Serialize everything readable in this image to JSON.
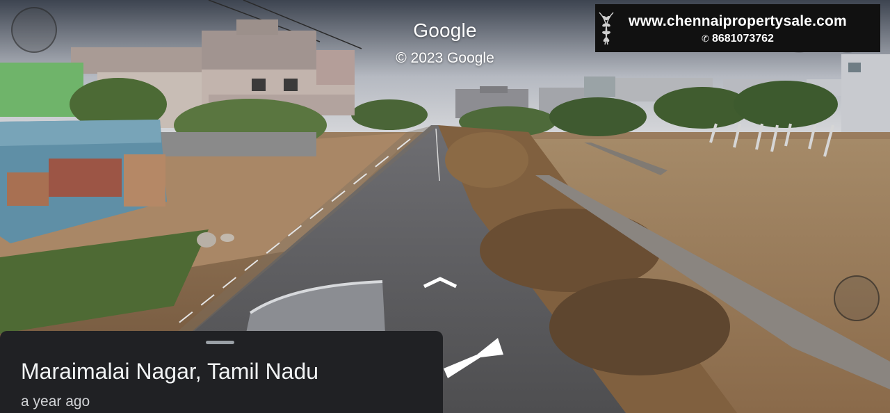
{
  "viewer": {
    "logo": "Google",
    "copyright": "© 2023 Google"
  },
  "banner": {
    "website": "www.chennaipropertysale.com",
    "phone": "8681073762",
    "phone_icon": "phone-icon"
  },
  "location_card": {
    "place": "Maraimalai Nagar, Tamil Nadu",
    "captured": "a year ago"
  },
  "colors": {
    "card_background": "#202124",
    "banner_background": "#111111",
    "road": "#5a5a5c",
    "sky": "#c9cbd0"
  }
}
